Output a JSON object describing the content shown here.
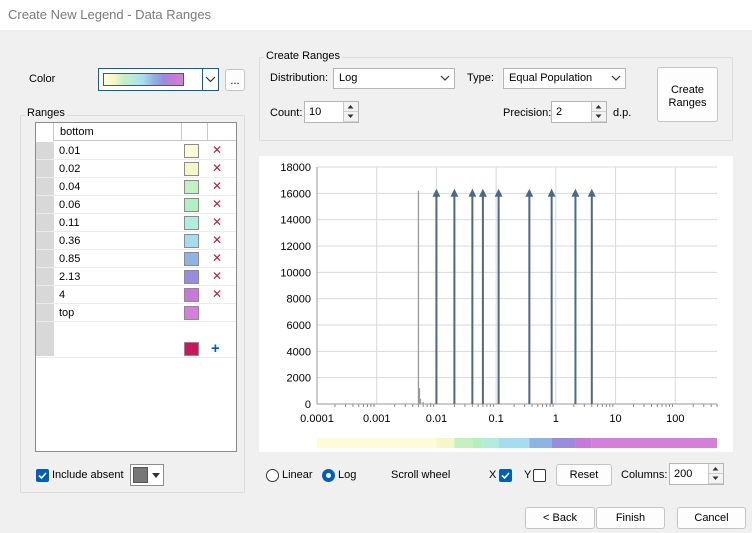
{
  "window": {
    "title": "Create New Legend - Data Ranges"
  },
  "color": {
    "label": "Color",
    "more_label": "..."
  },
  "ranges": {
    "group_label": "Ranges",
    "column_header": "bottom",
    "rows": [
      {
        "value": "0.01",
        "color": "#fdfbd8",
        "deletable": true
      },
      {
        "value": "0.02",
        "color": "#f6f7c8",
        "deletable": true
      },
      {
        "value": "0.04",
        "color": "#c4f0c2",
        "deletable": true
      },
      {
        "value": "0.06",
        "color": "#b3efbf",
        "deletable": true
      },
      {
        "value": "0.11",
        "color": "#b2ecdf",
        "deletable": true
      },
      {
        "value": "0.36",
        "color": "#a6dcef",
        "deletable": true
      },
      {
        "value": "0.85",
        "color": "#8fb4e4",
        "deletable": true
      },
      {
        "value": "2.13",
        "color": "#9a8be0",
        "deletable": true
      },
      {
        "value": "4",
        "color": "#c779d9",
        "deletable": true
      },
      {
        "value": "top",
        "color": "#d47fd9",
        "deletable": false
      }
    ],
    "add_row_color": "#c8175a",
    "add_label": "+",
    "delete_label": "✕"
  },
  "include_absent": {
    "label": "Include absent",
    "checked": true
  },
  "create_ranges": {
    "group_label": "Create Ranges",
    "distribution_label": "Distribution:",
    "distribution_value": "Log",
    "type_label": "Type:",
    "type_value": "Equal Population",
    "count_label": "Count:",
    "count_value": "10",
    "precision_label": "Precision:",
    "precision_value": "2",
    "precision_unit": "d.p.",
    "create_button": "Create Ranges"
  },
  "chart_data": {
    "type": "histogram",
    "xscale": "log",
    "xlim": [
      0.0001,
      500
    ],
    "ylim": [
      0,
      18000
    ],
    "yticks": [
      "0",
      "2000",
      "4000",
      "6000",
      "8000",
      "10000",
      "12000",
      "14000",
      "16000",
      "18000"
    ],
    "xticks": [
      "0.0001",
      "0.001",
      "0.01",
      "0.1",
      "1",
      "10",
      "100"
    ],
    "grid": true,
    "histogram_bars": [
      {
        "x": 0.005,
        "y": 16200
      },
      {
        "x": 0.0052,
        "y": 1200
      },
      {
        "x": 0.0054,
        "y": 400
      },
      {
        "x": 0.006,
        "y": 150
      },
      {
        "x": 0.008,
        "y": 80
      },
      {
        "x": 0.012,
        "y": 40
      }
    ],
    "breaks": [
      0.01,
      0.02,
      0.04,
      0.06,
      0.11,
      0.36,
      0.85,
      2.13,
      4
    ],
    "break_color": "#4b6a85",
    "color_ramp": [
      "#fdfbd8",
      "#f6f7c8",
      "#c4f0c2",
      "#b3efbf",
      "#b2ecdf",
      "#a6dcef",
      "#8fb4e4",
      "#9a8be0",
      "#c779d9",
      "#d47fd9"
    ]
  },
  "scale": {
    "linear_label": "Linear",
    "log_label": "Log",
    "selected": "Log",
    "scroll_label": "Scroll wheel",
    "x_label": "X",
    "x_checked": true,
    "y_label": "Y",
    "y_checked": false,
    "reset_label": "Reset",
    "columns_label": "Columns:",
    "columns_value": "200"
  },
  "footer": {
    "back_label": "< Back",
    "finish_label": "Finish",
    "cancel_label": "Cancel"
  }
}
